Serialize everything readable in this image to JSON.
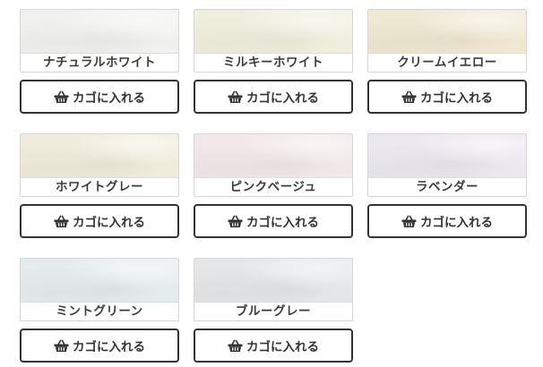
{
  "products": [
    {
      "name": "ナチュラルホワイト",
      "color": "#f1f1ef",
      "button_label": "カゴに入れる"
    },
    {
      "name": "ミルキーホワイト",
      "color": "#f0eedd",
      "button_label": "カゴに入れる"
    },
    {
      "name": "クリームイエロー",
      "color": "#efe9d3",
      "button_label": "カゴに入れる"
    },
    {
      "name": "ホワイトグレー",
      "color": "#f0ecdb",
      "button_label": "カゴに入れる"
    },
    {
      "name": "ピンクベージュ",
      "color": "#f1e8e9",
      "button_label": "カゴに入れる"
    },
    {
      "name": "ラベンダー",
      "color": "#ebe8ef",
      "button_label": "カゴに入れる"
    },
    {
      "name": "ミントグリーン",
      "color": "#e5eced",
      "button_label": "カゴに入れる"
    },
    {
      "name": "ブルーグレー",
      "color": "#e4e6e8",
      "button_label": "カゴに入れる"
    }
  ],
  "icons": {
    "cart": "basket-icon"
  }
}
